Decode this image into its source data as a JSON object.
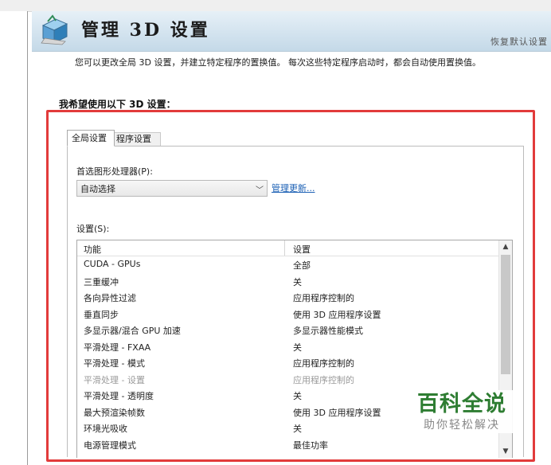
{
  "header": {
    "title": "管理 3D 设置",
    "restore_link": "恢复默认设置",
    "icon": "nvidia-3d-cube-icon"
  },
  "description": "您可以更改全局 3D 设置，并建立特定程序的置换值。 每次这些特定程序启动时，都会自动使用置换值。",
  "section_label": "我希望使用以下 3D 设置：",
  "tabs": [
    {
      "label": "全局设置",
      "active": true
    },
    {
      "label": "程序设置",
      "active": false
    }
  ],
  "gpu_select": {
    "label": "首选图形处理器(P):",
    "value": "自动选择",
    "update_link": "管理更新..."
  },
  "settings": {
    "label": "设置(S):",
    "columns": [
      "功能",
      "设置"
    ],
    "rows": [
      {
        "feature": "CUDA - GPUs",
        "value": "全部",
        "dim": false
      },
      {
        "feature": "三重缓冲",
        "value": "关",
        "dim": false
      },
      {
        "feature": "各向异性过滤",
        "value": "应用程序控制的",
        "dim": false
      },
      {
        "feature": "垂直同步",
        "value": "使用 3D 应用程序设置",
        "dim": false
      },
      {
        "feature": "多显示器/混合 GPU 加速",
        "value": "多显示器性能模式",
        "dim": false
      },
      {
        "feature": "平滑处理 - FXAA",
        "value": "关",
        "dim": false
      },
      {
        "feature": "平滑处理 - 模式",
        "value": "应用程序控制的",
        "dim": false
      },
      {
        "feature": "平滑处理 - 设置",
        "value": "应用程序控制的",
        "dim": true
      },
      {
        "feature": "平滑处理 - 透明度",
        "value": "关",
        "dim": false
      },
      {
        "feature": "最大预渲染帧数",
        "value": "使用 3D 应用程序设置",
        "dim": false
      },
      {
        "feature": "环境光吸收",
        "value": "关",
        "dim": false
      },
      {
        "feature": "电源管理模式",
        "value": "最佳功率",
        "dim": false
      }
    ]
  },
  "watermark": {
    "main": "百科全说",
    "sub": "助你轻松解决"
  },
  "colors": {
    "highlight_frame": "#e23b3b",
    "link": "#1a5fb4",
    "watermark": "#2e7d32"
  }
}
